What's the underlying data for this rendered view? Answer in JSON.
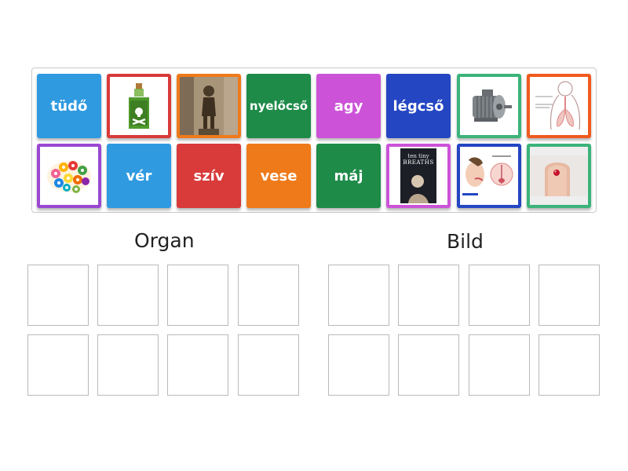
{
  "cards": {
    "row1": [
      {
        "kind": "text",
        "label": "tüdő",
        "color": "#2f9ae0"
      },
      {
        "kind": "image",
        "icon": "poison-bottle-icon",
        "frame": "#d93a3a"
      },
      {
        "kind": "image",
        "icon": "statue-photo-icon",
        "frame": "#ef7a1a"
      },
      {
        "kind": "text",
        "label": "nyelőcső",
        "color": "#1e8b49"
      },
      {
        "kind": "text",
        "label": "agy",
        "color": "#cc53d8"
      },
      {
        "kind": "text",
        "label": "légcső",
        "color": "#2446c2"
      },
      {
        "kind": "image",
        "icon": "electric-motor-icon",
        "frame": "#3cb37a"
      },
      {
        "kind": "image",
        "icon": "respiratory-diagram-icon",
        "frame": "#f05a1e"
      }
    ],
    "row2": [
      {
        "kind": "image",
        "icon": "gear-brain-icon",
        "frame": "#9a48d2"
      },
      {
        "kind": "text",
        "label": "vér",
        "color": "#2f9ae0"
      },
      {
        "kind": "text",
        "label": "szív",
        "color": "#d93a3a"
      },
      {
        "kind": "text",
        "label": "vese",
        "color": "#ef7a1a"
      },
      {
        "kind": "text",
        "label": "máj",
        "color": "#1e8b49"
      },
      {
        "kind": "image",
        "icon": "book-cover-icon",
        "frame": "#cc53d8",
        "cover_line1": "ten tiny",
        "cover_line2": "BREATHS"
      },
      {
        "kind": "image",
        "icon": "mouth-diagram-icon",
        "frame": "#2446c2"
      },
      {
        "kind": "image",
        "icon": "finger-blood-drop-icon",
        "frame": "#3cb37a"
      }
    ]
  },
  "columns": {
    "left_heading": "Organ",
    "right_heading": "Bild"
  }
}
